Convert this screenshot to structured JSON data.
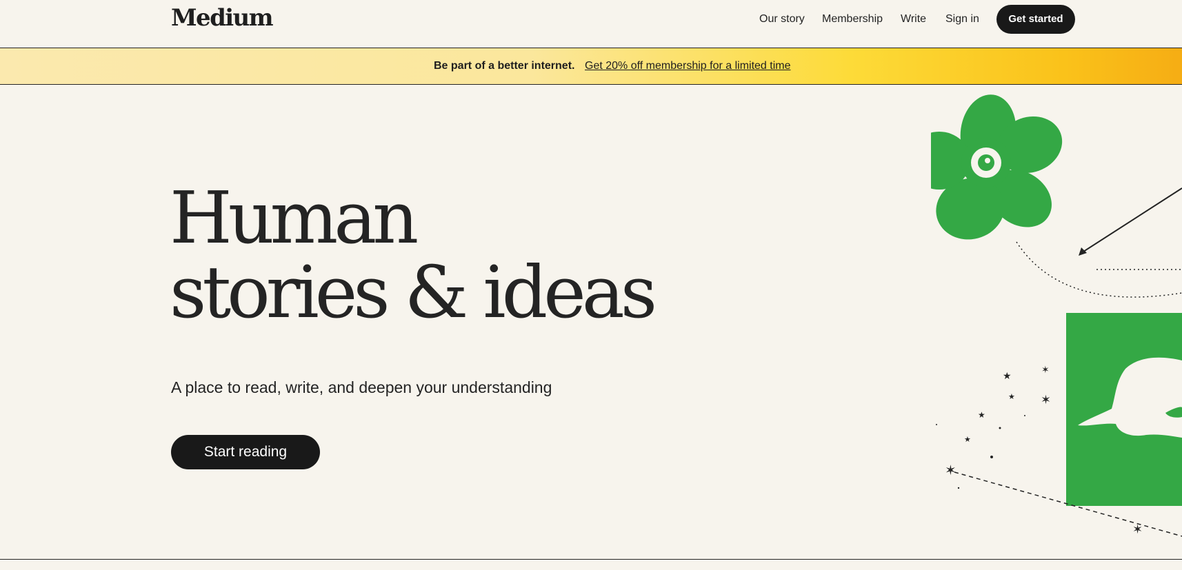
{
  "header": {
    "logo": "Medium",
    "nav": {
      "our_story": "Our story",
      "membership": "Membership",
      "write": "Write",
      "sign_in": "Sign in"
    },
    "cta": "Get started"
  },
  "banner": {
    "text": "Be part of a better internet.",
    "link": "Get 20% off membership for a limited time"
  },
  "hero": {
    "title_line1": "Human",
    "title_line2": "stories & ideas",
    "subtitle": "A place to read, write, and deepen your understanding",
    "cta": "Start reading"
  },
  "illustration": {
    "icons": [
      "flower-icon",
      "hand-icon",
      "star-icon",
      "arrow-icon"
    ],
    "flower_color": "#34a845",
    "panel_color": "#34a845"
  },
  "colors": {
    "background": "#f7f4ed",
    "text": "#242424",
    "button": "#191919",
    "banner_start": "#fbe9ae",
    "banner_end": "#f6ad14"
  }
}
